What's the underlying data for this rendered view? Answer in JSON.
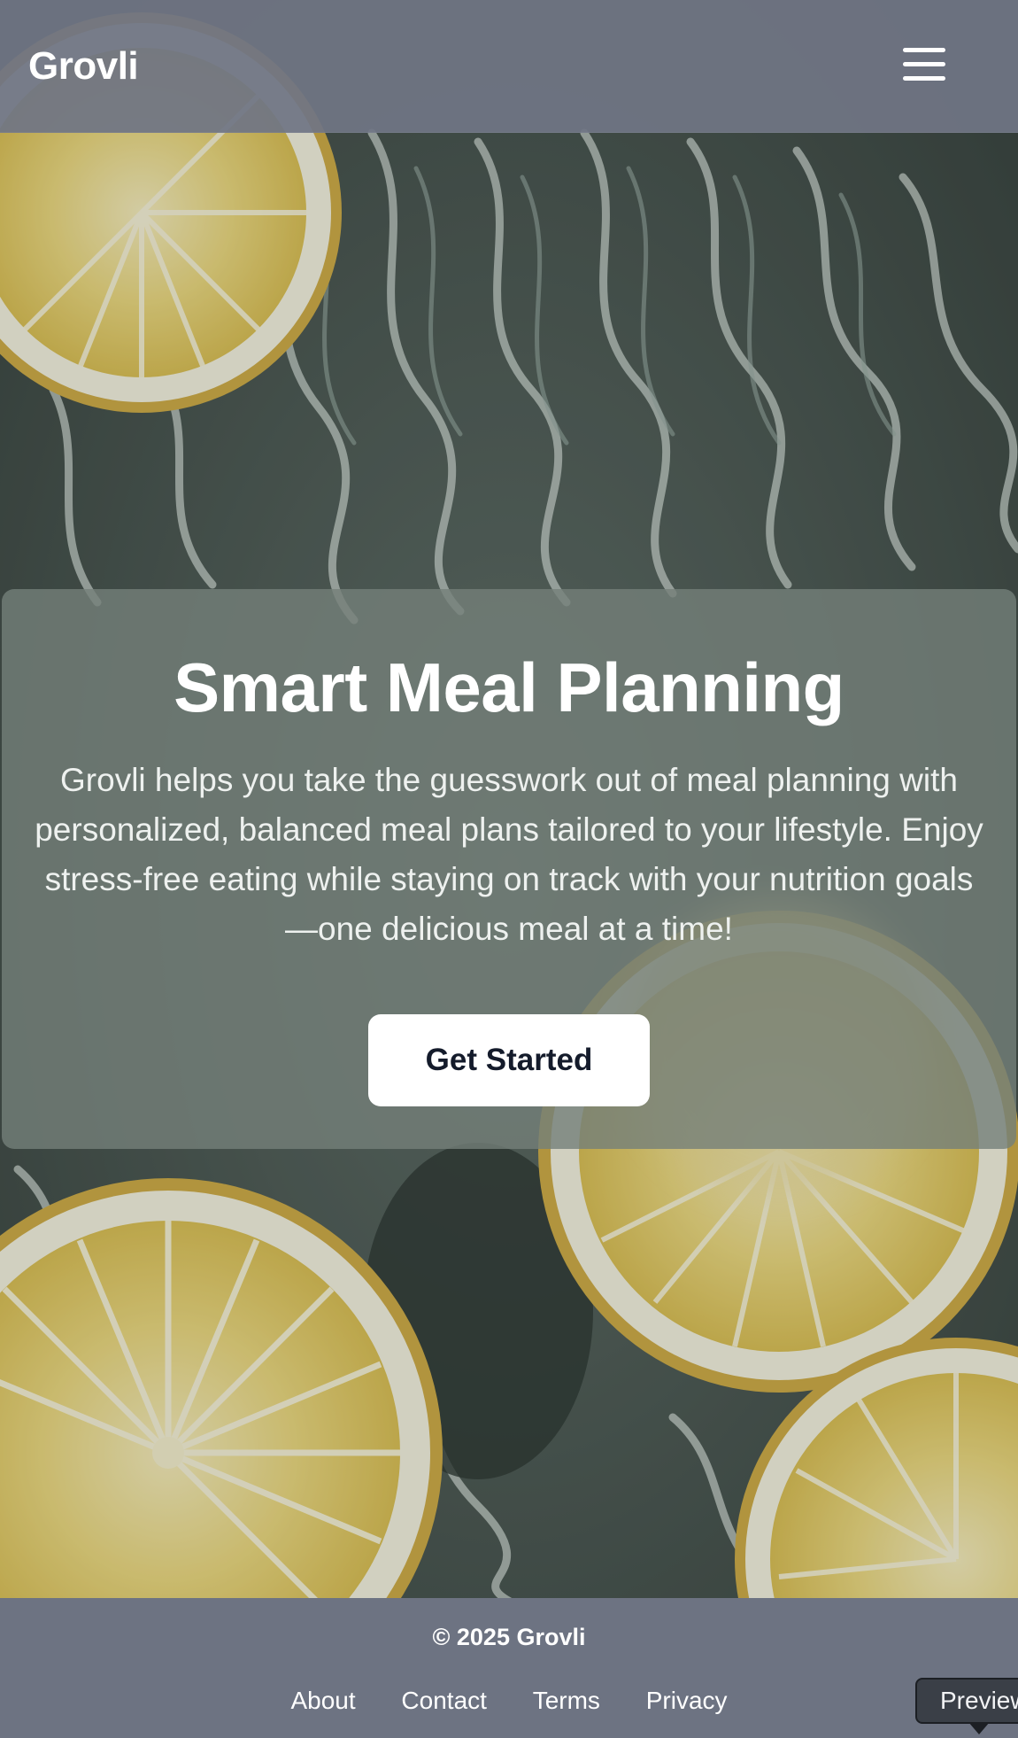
{
  "header": {
    "brand": "Grovli",
    "menu_icon": "hamburger-menu-icon"
  },
  "hero": {
    "title": "Smart Meal Planning",
    "description": "Grovli helps you take the guesswork out of meal planning with personalized, balanced meal plans tailored to your lifestyle. Enjoy stress-free eating while staying on track with your nutrition goals—one delicious meal at a time!",
    "cta_label": "Get Started"
  },
  "background": {
    "image": "lemon-slices-on-water-photo"
  },
  "footer": {
    "copyright": "© 2025 Grovli",
    "links": [
      "About",
      "Contact",
      "Terms",
      "Privacy"
    ]
  },
  "preview_badge": {
    "label": "Preview"
  },
  "colors": {
    "header_bg": "#707584",
    "footer_bg": "#6d7382",
    "cta_bg": "#ffffff",
    "cta_text": "#141b2b"
  }
}
